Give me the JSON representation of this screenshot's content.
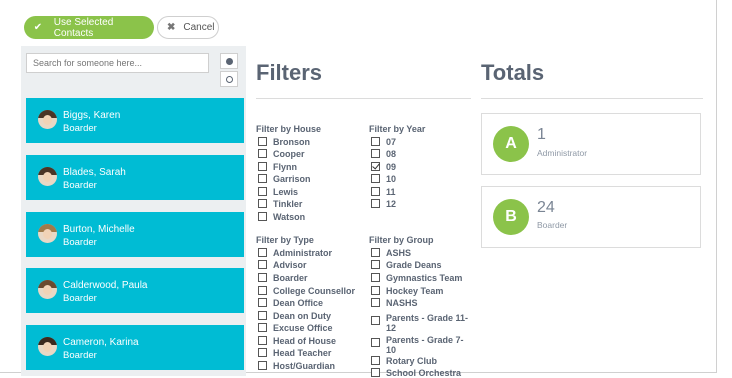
{
  "toolbar": {
    "use_label": "Use Selected Contacts",
    "cancel_label": "Cancel"
  },
  "search": {
    "placeholder": "Search for someone here..."
  },
  "contacts": [
    {
      "name": "Biggs, Karen",
      "role": "Boarder"
    },
    {
      "name": "Blades, Sarah",
      "role": "Boarder"
    },
    {
      "name": "Burton, Michelle",
      "role": "Boarder"
    },
    {
      "name": "Calderwood, Paula",
      "role": "Boarder"
    },
    {
      "name": "Cameron, Karina",
      "role": "Boarder"
    }
  ],
  "filters": {
    "title": "Filters",
    "house": {
      "title": "Filter by House",
      "options": [
        "Bronson",
        "Cooper",
        "Flynn",
        "Garrison",
        "Lewis",
        "Tinkler",
        "Watson"
      ]
    },
    "year": {
      "title": "Filter by Year",
      "options": [
        "07",
        "08",
        "09",
        "10",
        "11",
        "12"
      ],
      "checked": "09"
    },
    "type": {
      "title": "Filter by Type",
      "options": [
        "Administrator",
        "Advisor",
        "Boarder",
        "College Counsellor",
        "Dean Office",
        "Dean on Duty",
        "Excuse Office",
        "Head of House",
        "Head Teacher",
        "Host/Guardian"
      ]
    },
    "group": {
      "title": "Filter by Group",
      "options": [
        "ASHS",
        "Grade Deans",
        "Gymnastics Team",
        "Hockey Team",
        "NASHS",
        "Parents - Grade 11-12",
        "Parents - Grade 7-10",
        "Rotary Club",
        "School Orchestra"
      ]
    }
  },
  "totals": {
    "title": "Totals",
    "cards": [
      {
        "letter": "A",
        "count": "1",
        "label": "Administrator"
      },
      {
        "letter": "B",
        "count": "24",
        "label": "Boarder"
      }
    ]
  },
  "colors": {
    "accent_green": "#8bc34a",
    "contact_bg": "#00bcd4",
    "heading": "#5a6473"
  }
}
